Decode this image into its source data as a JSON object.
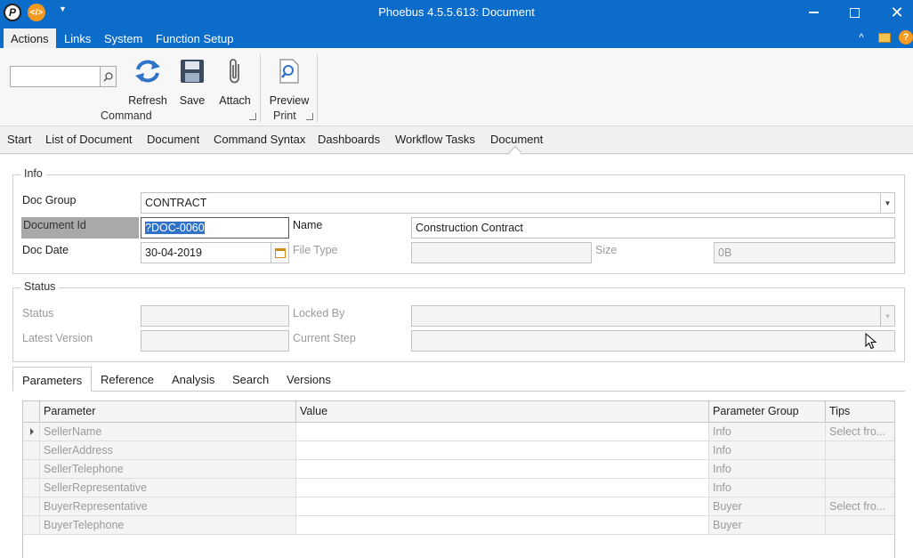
{
  "titlebar": {
    "title": "Phoebus 4.5.5.613: Document",
    "app_icon_glyph": "P",
    "quick_icon_glyph": "</>",
    "qa_dropdown_glyph": "▼",
    "close_glyph": "✕"
  },
  "menu": {
    "items": [
      "Actions",
      "Links",
      "System",
      "Function Setup"
    ],
    "active": "Actions",
    "collapse_glyph": "^",
    "help_glyph": "?"
  },
  "ribbon": {
    "search_value": "",
    "buttons": {
      "refresh": "Refresh",
      "save": "Save",
      "attach": "Attach",
      "preview": "Preview"
    },
    "groups": {
      "command": "Command",
      "print": "Print"
    }
  },
  "tabs": [
    "Start",
    "List of Document",
    "Document",
    "Command Syntax",
    "Dashboards",
    "Workflow Tasks",
    "Document"
  ],
  "active_tab_index": 6,
  "info": {
    "legend": "Info",
    "doc_group_label": "Doc Group",
    "doc_group_value": "CONTRACT",
    "document_id_label": "Document Id",
    "document_id_value": "?DOC-0060",
    "name_label": "Name",
    "name_value": "Construction Contract",
    "doc_date_label": "Doc Date",
    "doc_date_value": "30-04-2019",
    "file_type_label": "File Type",
    "file_type_value": "",
    "size_label": "Size",
    "size_value": "0B"
  },
  "status": {
    "legend": "Status",
    "status_label": "Status",
    "status_value": "",
    "locked_by_label": "Locked By",
    "locked_by_value": "",
    "latest_version_label": "Latest Version",
    "latest_version_value": "",
    "current_step_label": "Current Step",
    "current_step_value": ""
  },
  "bottom_tabs": [
    "Parameters",
    "Reference",
    "Analysis",
    "Search",
    "Versions"
  ],
  "bottom_active": "Parameters",
  "grid": {
    "columns": [
      "Parameter",
      "Value",
      "Parameter Group",
      "Tips"
    ],
    "rows": [
      {
        "parameter": "SellerName",
        "value": "",
        "group": "Info",
        "tips": "Select fro..."
      },
      {
        "parameter": "SellerAddress",
        "value": "",
        "group": "Info",
        "tips": ""
      },
      {
        "parameter": "SellerTelephone",
        "value": "",
        "group": "Info",
        "tips": ""
      },
      {
        "parameter": "SellerRepresentative",
        "value": "",
        "group": "Info",
        "tips": ""
      },
      {
        "parameter": "BuyerRepresentative",
        "value": "",
        "group": "Buyer",
        "tips": "Select fro..."
      },
      {
        "parameter": "BuyerTelephone",
        "value": "",
        "group": "Buyer",
        "tips": ""
      }
    ]
  },
  "colors": {
    "titlebar": "#0b6cc9",
    "selection": "#2f73c8",
    "accent_orange": "#f59a1e"
  }
}
